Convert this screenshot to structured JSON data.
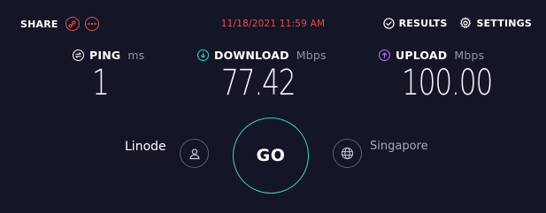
{
  "header": {
    "share_label": "SHARE",
    "datetime": "11/18/2021 11:59 AM",
    "results_label": "RESULTS",
    "settings_label": "SETTINGS"
  },
  "metrics": {
    "ping": {
      "label": "PING",
      "unit": "ms",
      "value": "1"
    },
    "download": {
      "label": "DOWNLOAD",
      "unit": "Mbps",
      "value": "77.42"
    },
    "upload": {
      "label": "UPLOAD",
      "unit": "Mbps",
      "value": "100.00"
    }
  },
  "connection": {
    "isp": "Linode",
    "server": "Singapore",
    "go_label": "GO"
  },
  "icons": {
    "share_link": "link-icon",
    "share_more": "more-icon",
    "results": "check-circle-icon",
    "settings": "gear-icon",
    "ping": "ping-icon",
    "download": "download-arrow-icon",
    "upload": "upload-arrow-icon",
    "isp": "user-icon",
    "server": "globe-icon"
  },
  "colors": {
    "background": "#141526",
    "accent_red": "#e94b4b",
    "accent_cyan": "#3fd2d2",
    "accent_purple": "#b679f0",
    "muted_text": "#9193a8"
  }
}
